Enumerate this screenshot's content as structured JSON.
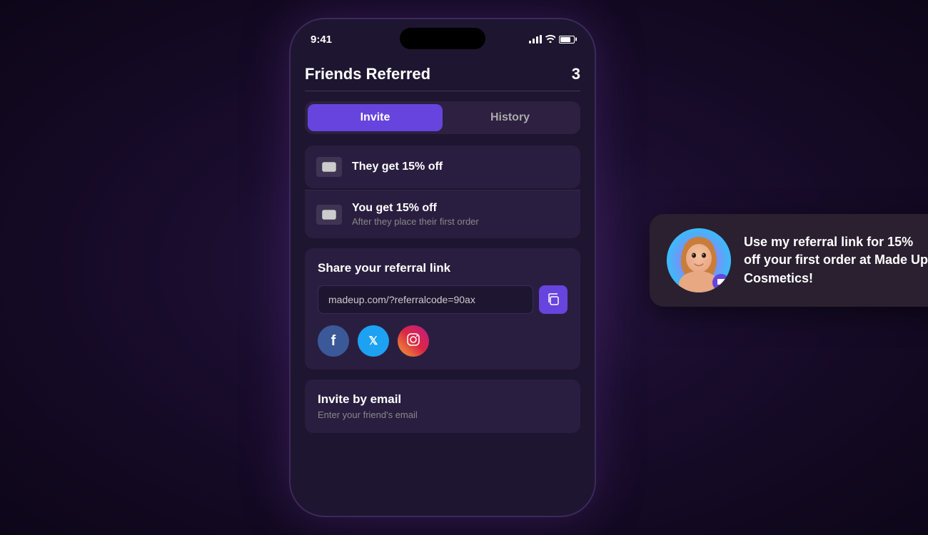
{
  "page": {
    "background": "dark purple gradient"
  },
  "statusBar": {
    "time": "9:41",
    "signal": "●●●●",
    "wifi": "wifi",
    "battery": "battery"
  },
  "header": {
    "title": "Friends Referred",
    "count": "3"
  },
  "tabs": [
    {
      "id": "invite",
      "label": "Invite",
      "active": true
    },
    {
      "id": "history",
      "label": "History",
      "active": false
    }
  ],
  "benefits": [
    {
      "id": "they-get",
      "icon": "coupon-icon",
      "text": "They get 15% off",
      "subtext": null
    },
    {
      "id": "you-get",
      "icon": "coupon-icon",
      "text": "You get 15% off",
      "subtext": "After they place their first order"
    }
  ],
  "shareSection": {
    "title": "Share your referral link",
    "referralUrl": "madeup.com/?referralcode=90ax",
    "copyButtonLabel": "copy",
    "socials": [
      {
        "id": "facebook",
        "label": "f",
        "platform": "Facebook"
      },
      {
        "id": "twitter",
        "label": "t",
        "platform": "Twitter"
      },
      {
        "id": "instagram",
        "label": "ig",
        "platform": "Instagram"
      }
    ]
  },
  "inviteByEmail": {
    "title": "Invite by email",
    "subtitle": "Enter your friend's email"
  },
  "notification": {
    "text": "Use my referral link for 15% off your first order at Made Up Cosmetics!"
  }
}
